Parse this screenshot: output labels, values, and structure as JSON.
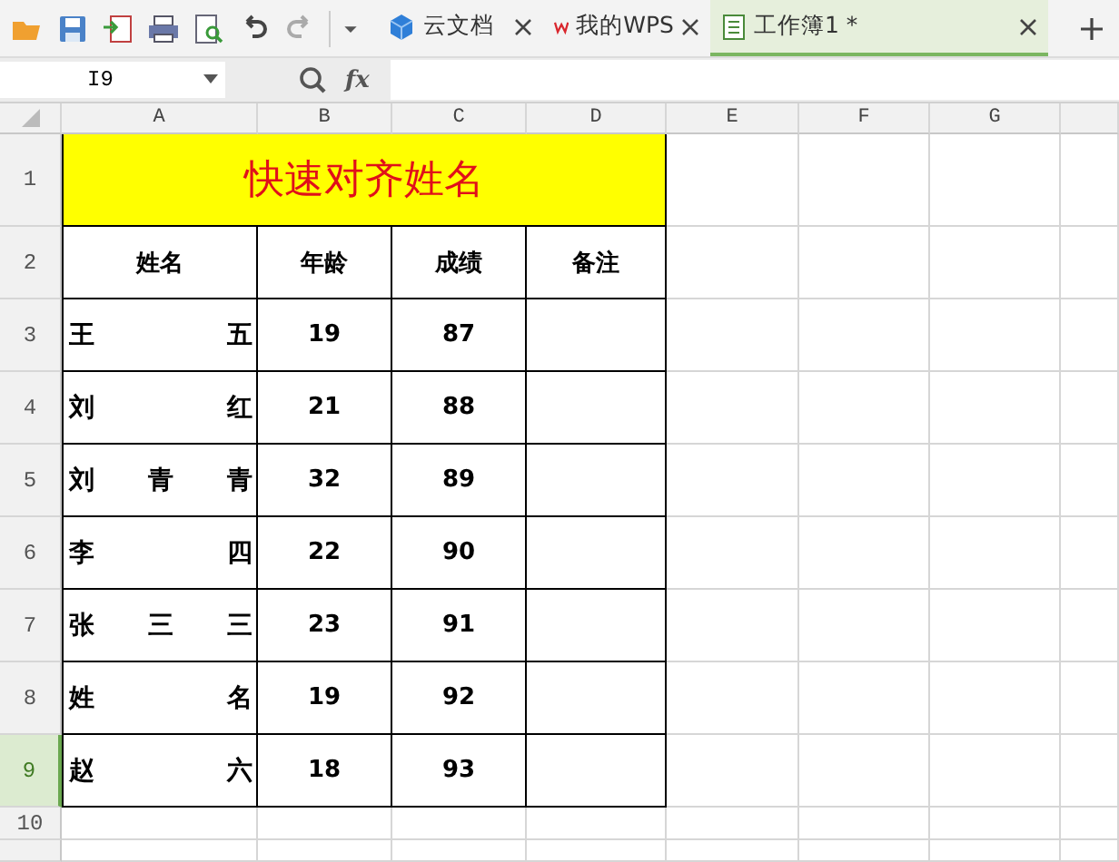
{
  "tabs": [
    {
      "label": "云文档",
      "kind": "cloud",
      "selected": false
    },
    {
      "label": "我的WPS",
      "kind": "home",
      "selected": false
    },
    {
      "label": "工作簿1 *",
      "kind": "workbook",
      "selected": true
    }
  ],
  "formula_bar": {
    "cell_ref": "I9",
    "function_label": "fx"
  },
  "columns": [
    "A",
    "B",
    "C",
    "D",
    "E",
    "F",
    "G"
  ],
  "row_numbers": [
    {
      "label": "1",
      "selected": false
    },
    {
      "label": "2",
      "selected": false
    },
    {
      "label": "3",
      "selected": false
    },
    {
      "label": "4",
      "selected": false
    },
    {
      "label": "5",
      "selected": false
    },
    {
      "label": "6",
      "selected": false
    },
    {
      "label": "7",
      "selected": false
    },
    {
      "label": "8",
      "selected": false
    },
    {
      "label": "9",
      "selected": true
    },
    {
      "label": "10",
      "selected": false
    }
  ],
  "sheet": {
    "title": "快速对齐姓名",
    "headers": [
      "姓名",
      "年龄",
      "成绩",
      "备注"
    ],
    "records": [
      {
        "name": "王五",
        "age": "19",
        "score": "87"
      },
      {
        "name": "刘红",
        "age": "21",
        "score": "88"
      },
      {
        "name": "刘青青",
        "age": "32",
        "score": "89"
      },
      {
        "name": "李四",
        "age": "22",
        "score": "90"
      },
      {
        "name": "张三三",
        "age": "23",
        "score": "91"
      },
      {
        "name": "姓名",
        "age": "19",
        "score": "92"
      },
      {
        "name": "赵六",
        "age": "18",
        "score": "93"
      }
    ]
  }
}
